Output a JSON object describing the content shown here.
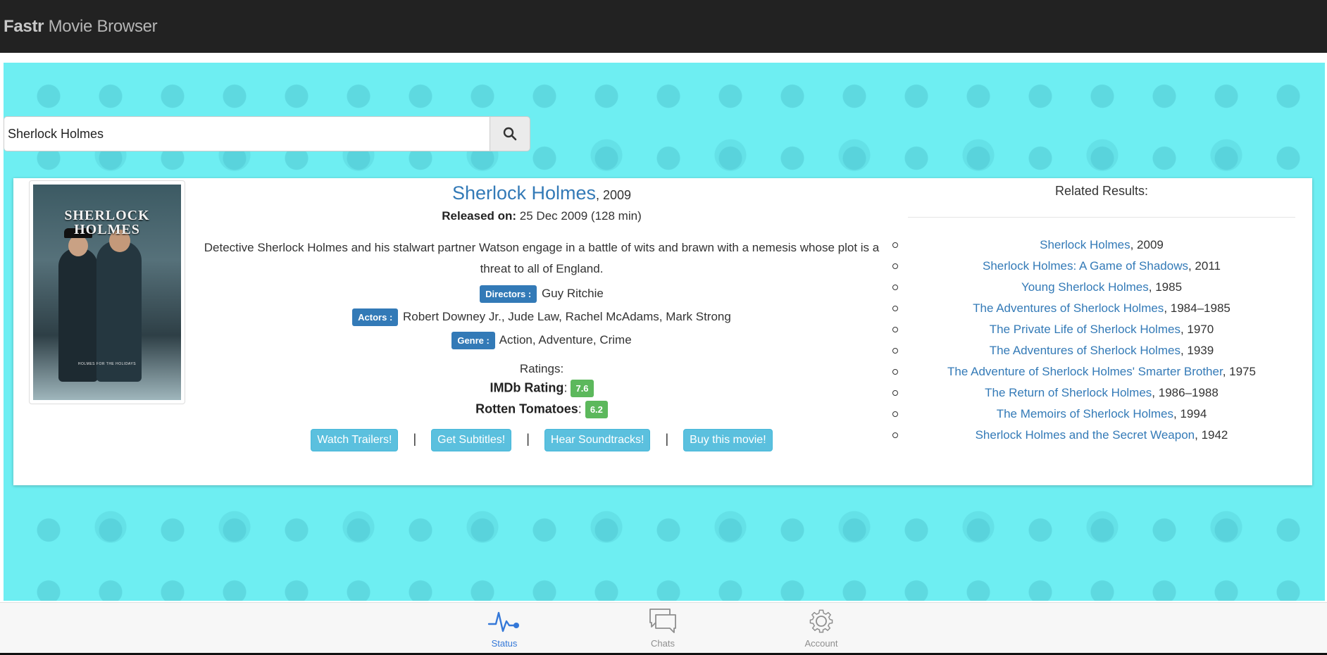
{
  "navbar": {
    "brand_bold": "Fastr",
    "brand_rest": " Movie Browser"
  },
  "search": {
    "value": "Sherlock Holmes",
    "icon": "search-icon"
  },
  "movie": {
    "title": "Sherlock Holmes",
    "year": ", 2009",
    "released_label": "Released on:",
    "released_value": " 25 Dec 2009 (128 min)",
    "plot": "Detective Sherlock Holmes and his stalwart partner Watson engage in a battle of wits and brawn with a nemesis whose plot is a threat to all of England.",
    "poster": {
      "title_line1": "SHERLOCK",
      "title_line2": "HOLMES",
      "tagline": "HOLMES FOR THE HOLIDAYS"
    },
    "directors_label": "Directors :",
    "directors": "Guy Ritchie",
    "actors_label": "Actors :",
    "actors": "Robert Downey Jr., Jude Law, Rachel McAdams, Mark Strong",
    "genre_label": "Genre :",
    "genre": "Action, Adventure, Crime",
    "ratings_title": "Ratings:",
    "imdb_label": "IMDb Rating",
    "imdb_value": "7.6",
    "rt_label": "Rotten Tomatoes",
    "rt_value": "6.2",
    "colon": ":"
  },
  "actions": {
    "trailers": "Watch Trailers!",
    "subtitles": "Get Subtitles!",
    "soundtracks": "Hear Soundtracks!",
    "buy": "Buy this movie!",
    "separator": "|"
  },
  "related": {
    "title": "Related Results:",
    "items": [
      {
        "title": "Sherlock Holmes",
        "year": ", 2009"
      },
      {
        "title": "Sherlock Holmes: A Game of Shadows",
        "year": ", 2011"
      },
      {
        "title": "Young Sherlock Holmes",
        "year": ", 1985"
      },
      {
        "title": "The Adventures of Sherlock Holmes",
        "year": ", 1984–1985"
      },
      {
        "title": "The Private Life of Sherlock Holmes",
        "year": ", 1970"
      },
      {
        "title": "The Adventures of Sherlock Holmes",
        "year": ", 1939"
      },
      {
        "title": "The Adventure of Sherlock Holmes' Smarter Brother",
        "year": ", 1975"
      },
      {
        "title": "The Return of Sherlock Holmes",
        "year": ", 1986–1988"
      },
      {
        "title": "The Memoirs of Sherlock Holmes",
        "year": ", 1994"
      },
      {
        "title": "Sherlock Holmes and the Secret Weapon",
        "year": ", 1942"
      }
    ]
  },
  "tabbar": {
    "tabs": [
      {
        "label": "Status",
        "icon": "pulse-icon",
        "active": true
      },
      {
        "label": "Chats",
        "icon": "chat-bubbles-icon",
        "active": false
      },
      {
        "label": "Account",
        "icon": "gear-icon",
        "active": false
      }
    ]
  },
  "colors": {
    "navbar": "#222222",
    "background_pattern": "#6eeef2",
    "link": "#337ab7",
    "label": "#337ab7",
    "rating_badge": "#5cb85c",
    "action_button": "#5bc0de",
    "active_tab": "#3478d8"
  }
}
